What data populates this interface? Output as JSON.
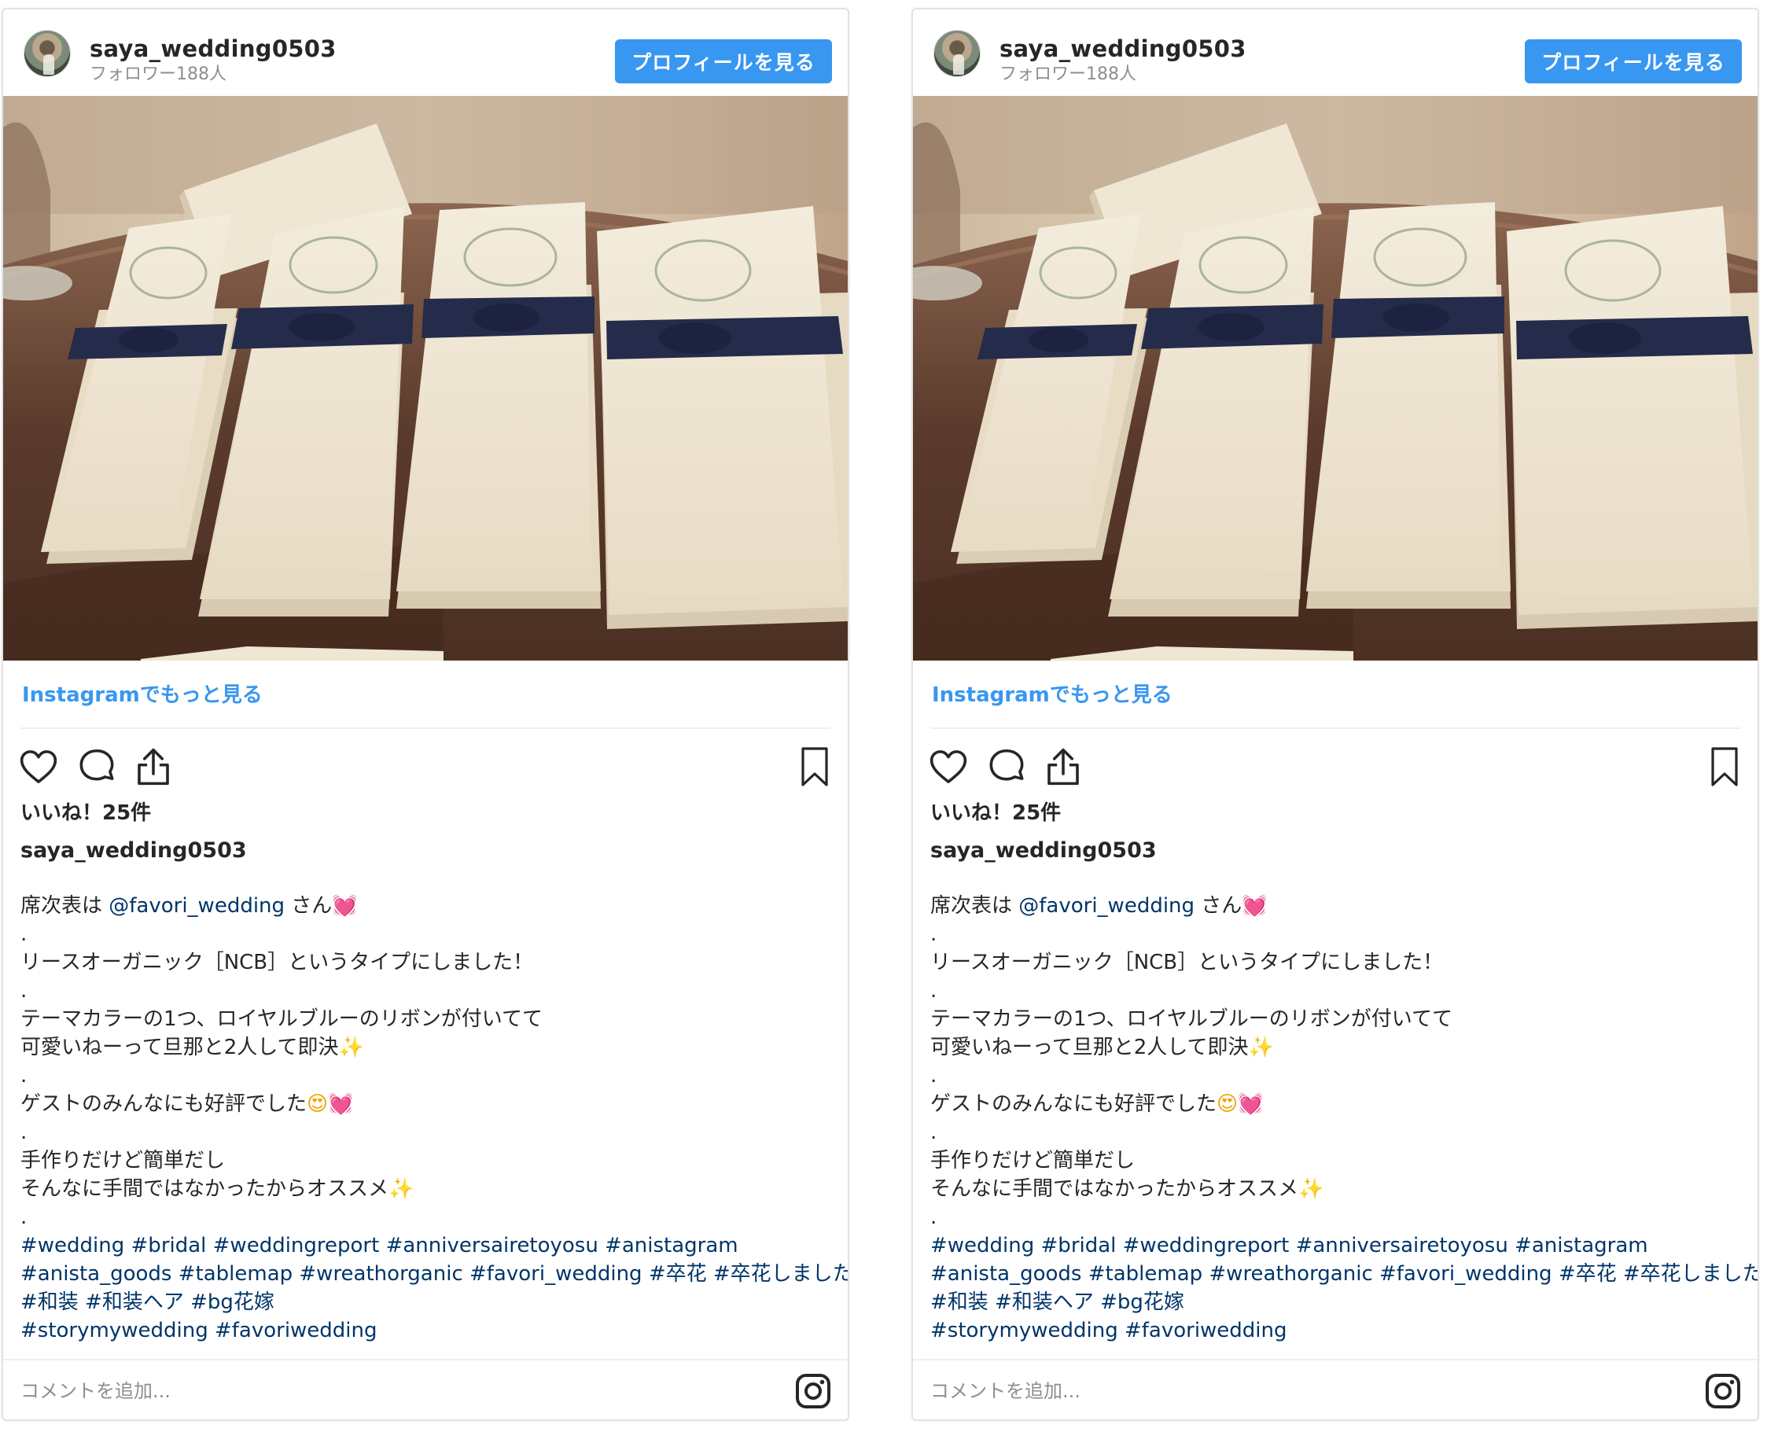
{
  "posts": [
    {
      "username": "saya_wedding0503",
      "followers": "フォロワー188人",
      "profile_button": "プロフィールを見る",
      "more_link": "Instagramでもっと見る",
      "likes": "いいね！25件",
      "caption_user": "saya_wedding0503",
      "caption": {
        "l1_text": "席次表は ",
        "l1_mention": "@favori_wedding",
        "l1_suffix": " さん",
        "l2": ".",
        "l3": "リースオーガニック［NCB］というタイプにしました！",
        "l4": ".",
        "l5": "テーマカラーの1つ、ロイヤルブルーのリボンが付いてて",
        "l6": "可愛いねーって旦那と2人して即決",
        "l7": ".",
        "l8": "ゲストのみんなにも好評でした",
        "l9": ".",
        "l10": "手作りだけど簡単だし",
        "l11": "そんなに手間ではなかったからオススメ",
        "l12": ".",
        "tags1": "#wedding #bridal #weddingreport #anniversairetoyosu #anistagram",
        "tags2": "#anista_goods #tablemap #wreathorganic #favori_wedding #卒花 #卒花しました",
        "tags3": "#和装 #和装ヘア #bg花嫁",
        "tags4": "#storymywedding #favoriwedding"
      },
      "comment_placeholder": "コメントを追加..."
    },
    {
      "username": "saya_wedding0503",
      "followers": "フォロワー188人",
      "profile_button": "プロフィールを見る",
      "more_link": "Instagramでもっと見る",
      "likes": "いいね！25件",
      "caption_user": "saya_wedding0503",
      "caption": {
        "l1_text": "席次表は ",
        "l1_mention": "@favori_wedding",
        "l1_suffix": " さん",
        "l2": ".",
        "l3": "リースオーガニック［NCB］というタイプにしました！",
        "l4": ".",
        "l5": "テーマカラーの1つ、ロイヤルブルーのリボンが付いてて",
        "l6": "可愛いねーって旦那と2人して即決",
        "l7": ".",
        "l8": "ゲストのみんなにも好評でした",
        "l9": ".",
        "l10": "手作りだけど簡単だし",
        "l11": "そんなに手間ではなかったからオススメ",
        "l12": ".",
        "tags1": "#wedding #bridal #weddingreport #anniversairetoyosu #anistagram",
        "tags2": "#anista_goods #tablemap #wreathorganic #favori_wedding #卒花 #卒花しました",
        "tags3": "#和装 #和装ヘア #bg花嫁",
        "tags4": "#storymywedding #favoriwedding"
      },
      "comment_placeholder": "コメントを追加..."
    }
  ],
  "emoji": {
    "heart": "💓",
    "sparkle": "✨",
    "heart_eyes": "😍"
  },
  "colors": {
    "accent_blue": "#3897f0",
    "link_navy": "#003569",
    "muted": "#8e8e8e",
    "text": "#262626",
    "ribbon_navy": "#252b4a"
  },
  "icons": {
    "like": "heart-outline-icon",
    "comment": "speech-bubble-icon",
    "share": "share-upload-icon",
    "save": "bookmark-icon",
    "brand": "instagram-logo-icon"
  }
}
